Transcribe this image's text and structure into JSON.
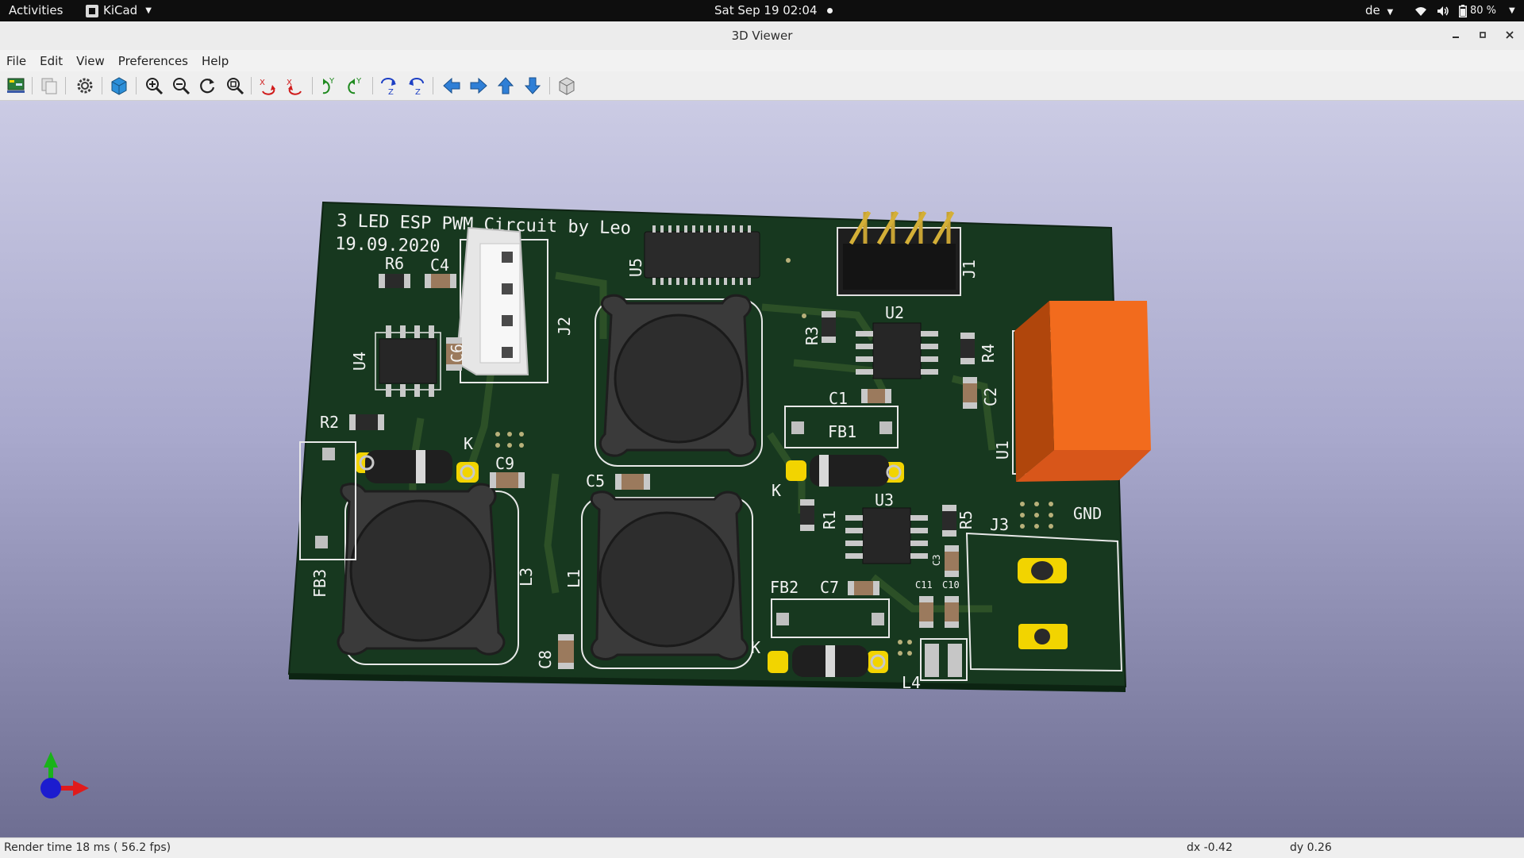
{
  "topbar": {
    "activities": "Activities",
    "app_name": "KiCad",
    "clock": "Sat Sep 19  02:04",
    "language": "de",
    "battery": "80 %"
  },
  "window": {
    "title": "3D Viewer"
  },
  "menu": [
    "File",
    "Edit",
    "View",
    "Preferences",
    "Help"
  ],
  "toolbar": {
    "buttons": [
      "reload-board-icon",
      "copy-image-icon",
      "render-options-icon",
      "raytracing-icon",
      "zoom-in-icon",
      "zoom-out-icon",
      "redraw-icon",
      "zoom-fit-icon",
      "rotate-x-cw-icon",
      "rotate-x-ccw-icon",
      "rotate-y-cw-icon",
      "rotate-y-ccw-icon",
      "rotate-z-cw-icon",
      "rotate-z-ccw-icon",
      "pan-left-icon",
      "pan-right-icon",
      "pan-up-icon",
      "pan-down-icon",
      "orthographic-icon"
    ]
  },
  "board": {
    "title_line1": "3 LED ESP PWM Circuit by Leo",
    "title_line2": "19.09.2020",
    "labels": {
      "R6": "R6",
      "C4": "C4",
      "U5": "U5",
      "J1": "J1",
      "J2": "J2",
      "U4": "U4",
      "C6": "C6",
      "R3": "R3",
      "U2": "U2",
      "R4": "R4",
      "C1": "C1",
      "C2": "C2",
      "FB1": "FB1",
      "U1": "U1",
      "R2": "R2",
      "K": "K",
      "C9": "C9",
      "C5": "C5",
      "R1": "R1",
      "U3": "U3",
      "R5": "R5",
      "J3": "J3",
      "GND": "GND",
      "FB3": "FB3",
      "L3": "L3",
      "L1": "L1",
      "C3": "C3",
      "FB2": "FB2",
      "C7": "C7",
      "C11": "C11",
      "C10": "C10",
      "C8": "C8",
      "L4": "L4"
    }
  },
  "axis": {
    "x_color": "#e01b1b",
    "y_color": "#19b319",
    "z_color": "#1c1ccf"
  },
  "status": {
    "render_time": "Render time 18 ms ( 56.2 fps)",
    "dx": "dx -0.42",
    "dy": "dy 0.26"
  }
}
